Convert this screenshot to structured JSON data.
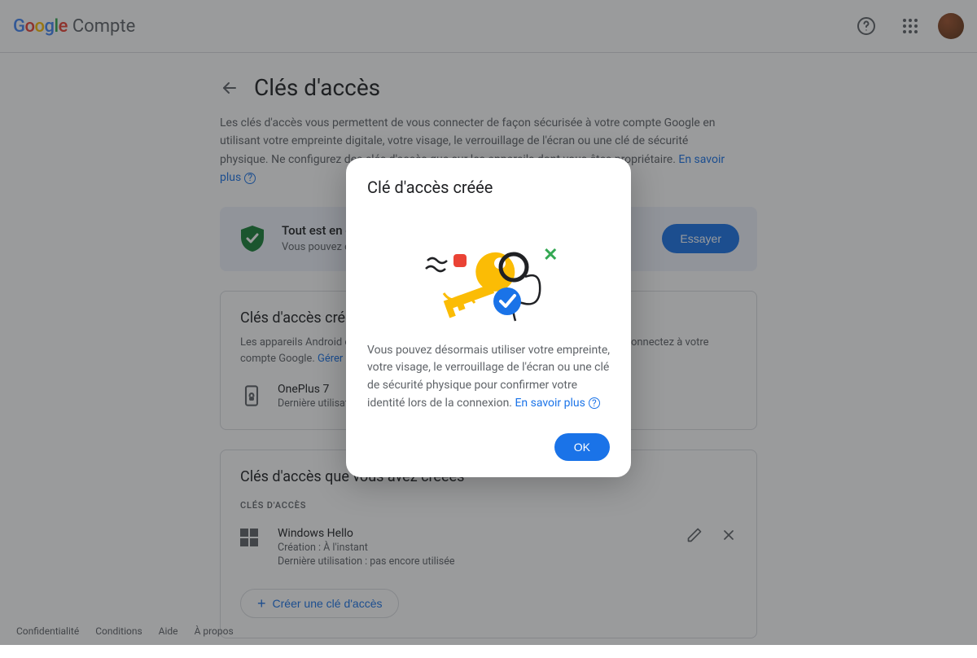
{
  "header": {
    "product": "Compte",
    "help_tooltip": "Aide",
    "apps_tooltip": "Applications Google"
  },
  "page": {
    "title": "Clés d'accès",
    "intro": "Les clés d'accès vous permettent de vous connecter de façon sécurisée à votre compte Google en utilisant votre empreinte digitale, votre visage, le verrouillage de l'écran ou une clé de sécurité physique. Ne configurez des clés d'accès que sur les appareils dont vous êtes propriétaire. ",
    "learn_more": "En savoir plus"
  },
  "status": {
    "title": "Tout est en ordre",
    "subtitle": "Vous pouvez désormais vous connecter avec le verrouillage de l'écran…",
    "try_button": "Essayer"
  },
  "auto_section": {
    "title": "Clés d'accès créées automatiquement",
    "desc_prefix": "Les appareils Android créent automatiquement une clé d'accès lorsque vous vous connectez à votre compte Google. ",
    "manage_link": "Gérer les appareils",
    "device": {
      "name": "OnePlus 7",
      "sub": "Dernière utilisation…"
    }
  },
  "user_section": {
    "title": "Clés d'accès que vous avez créées",
    "label": "CLÉS D'ACCÈS",
    "device": {
      "name": "Windows Hello",
      "created": "Création : À l'instant",
      "last_used": "Dernière utilisation : pas encore utilisée"
    },
    "create_button": "Créer une clé d'accès"
  },
  "modal": {
    "title": "Clé d'accès créée",
    "body": "Vous pouvez désormais utiliser votre empreinte, votre visage, le verrouillage de l'écran ou une clé de sécurité physique pour confirmer votre identité lors de la connexion. ",
    "learn_more": "En savoir plus",
    "ok": "OK"
  },
  "footer": {
    "privacy": "Confidentialité",
    "terms": "Conditions",
    "help": "Aide",
    "about": "À propos"
  }
}
